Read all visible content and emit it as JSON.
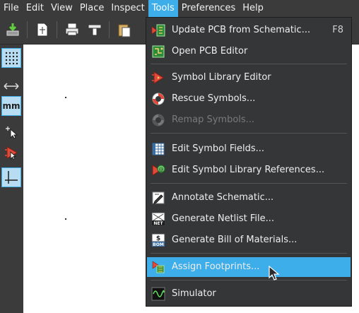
{
  "menubar": {
    "items": [
      "File",
      "Edit",
      "View",
      "Place",
      "Inspect",
      "Tools",
      "Preferences",
      "Help"
    ],
    "open_menu": "Tools"
  },
  "tools_menu": {
    "items": [
      {
        "label": "Update PCB from Schematic...",
        "shortcut": "F8",
        "icon": "update-pcb-icon",
        "enabled": true
      },
      {
        "label": "Open PCB Editor",
        "icon": "pcb-editor-icon",
        "enabled": true
      },
      {
        "label": "Symbol Library Editor",
        "icon": "symbol-library-editor-icon",
        "enabled": true
      },
      {
        "label": "Rescue Symbols...",
        "icon": "lifebuoy-icon",
        "enabled": true
      },
      {
        "label": "Remap Symbols...",
        "icon": "lifebuoy-icon",
        "enabled": false
      },
      {
        "label": "Edit Symbol Fields...",
        "icon": "grid-table-icon",
        "enabled": true
      },
      {
        "label": "Edit Symbol Library References...",
        "icon": "library-reference-icon",
        "enabled": true
      },
      {
        "label": "Annotate Schematic...",
        "icon": "annotate-pencil-icon",
        "enabled": true
      },
      {
        "label": "Generate Netlist File...",
        "icon": "netlist-icon",
        "enabled": true
      },
      {
        "label": "Generate Bill of Materials...",
        "icon": "bom-icon",
        "enabled": true
      },
      {
        "label": "Assign Footprints...",
        "icon": "assign-footprints-icon",
        "enabled": true,
        "highlighted": true
      },
      {
        "label": "Simulator",
        "icon": "simulator-scope-icon",
        "enabled": true
      }
    ],
    "icon_texts": {
      "netlist": "NET",
      "bom": "BOM",
      "dollar": "$"
    }
  },
  "left_toolbar": {
    "tools": [
      "grid-toggle-icon",
      "horizontal-arrows-icon",
      "units-mm-icon",
      "cursor-select-icon",
      "symbol-highlight-icon",
      "crosshair-cursor-icon"
    ],
    "units_label": "mm"
  },
  "colors": {
    "accent": "#3daee9",
    "menu_background": "#353637",
    "toolbar_background": "#3b3b3b",
    "disabled_text": "#7a7a7a"
  }
}
